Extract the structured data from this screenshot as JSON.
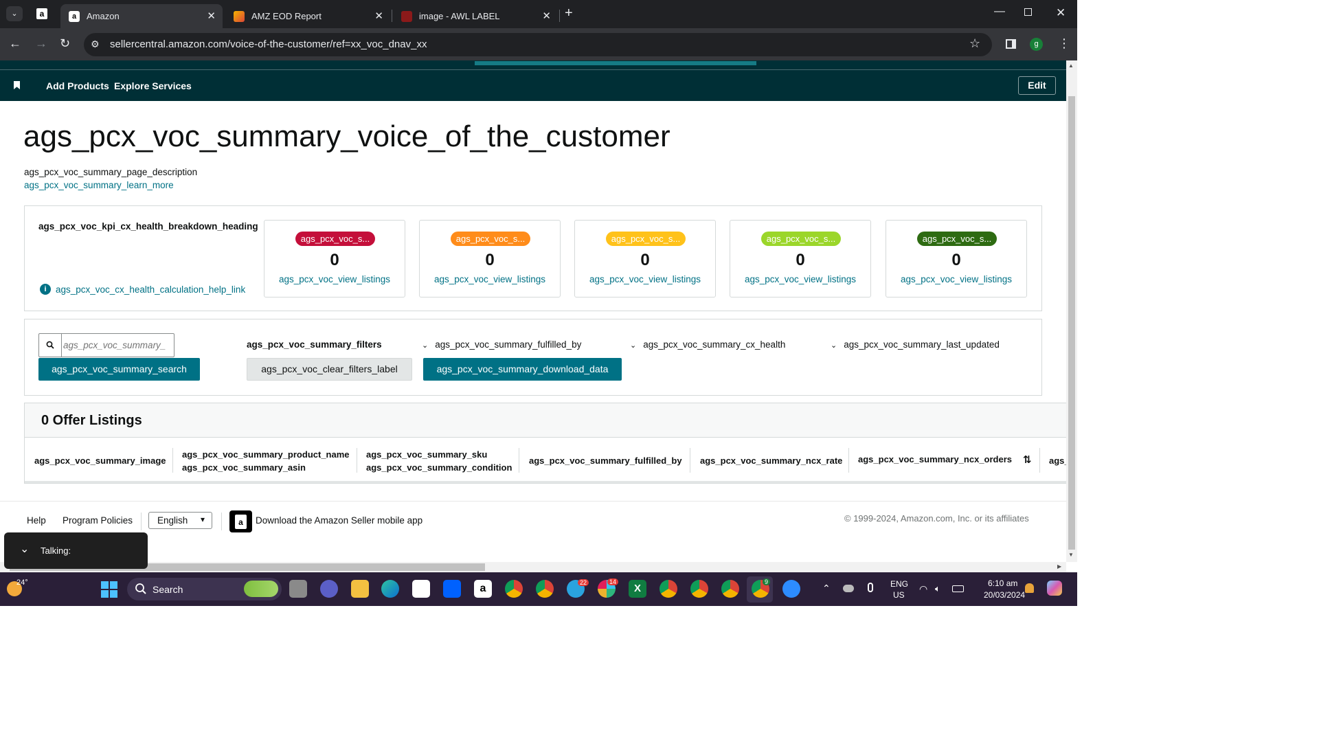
{
  "browser": {
    "tabs": [
      {
        "label": "Amazon",
        "active": true
      },
      {
        "label": "AMZ EOD Report",
        "active": false
      },
      {
        "label": "image - AWL LABEL",
        "active": false
      }
    ],
    "url": "sellercentral.amazon.com/voice-of-the-customer/ref=xx_voc_dnav_xx",
    "profile_letter": "g"
  },
  "nav": {
    "add_products": "Add Products",
    "explore_services": "Explore Services",
    "edit": "Edit"
  },
  "page": {
    "title": "ags_pcx_voc_summary_voice_of_the_customer",
    "description": "ags_pcx_voc_summary_page_description",
    "learn_more": "ags_pcx_voc_summary_learn_more"
  },
  "kpi": {
    "heading": "ags_pcx_voc_kpi_cx_health_breakdown_heading",
    "help_link": "ags_pcx_voc_cx_health_calculation_help_link",
    "cards": [
      {
        "pill": "ags_pcx_voc_s...",
        "color": "#c40f3a",
        "value": "0",
        "link": "ags_pcx_voc_view_listings"
      },
      {
        "pill": "ags_pcx_voc_s...",
        "color": "#ff8c1a",
        "value": "0",
        "link": "ags_pcx_voc_view_listings"
      },
      {
        "pill": "ags_pcx_voc_s...",
        "color": "#ffc21a",
        "value": "0",
        "link": "ags_pcx_voc_view_listings"
      },
      {
        "pill": "ags_pcx_voc_s...",
        "color": "#9bd62a",
        "value": "0",
        "link": "ags_pcx_voc_view_listings"
      },
      {
        "pill": "ags_pcx_voc_s...",
        "color": "#2e6b12",
        "value": "0",
        "link": "ags_pcx_voc_view_listings"
      }
    ]
  },
  "filters": {
    "search_placeholder": "ags_pcx_voc_summary_",
    "search_button": "ags_pcx_voc_summary_search",
    "filters_label": "ags_pcx_voc_summary_filters",
    "clear_filters": "ags_pcx_voc_clear_filters_label",
    "download": "ags_pcx_voc_summary_download_data",
    "dropdowns": [
      "ags_pcx_voc_summary_fulfilled_by",
      "ags_pcx_voc_summary_cx_health",
      "ags_pcx_voc_summary_last_updated"
    ]
  },
  "listings": {
    "heading": "0 Offer Listings",
    "columns": {
      "image": "ags_pcx_voc_summary_image",
      "product_name": "ags_pcx_voc_summary_product_name",
      "asin": "ags_pcx_voc_summary_asin",
      "sku": "ags_pcx_voc_summary_sku",
      "condition": "ags_pcx_voc_summary_condition",
      "fulfilled_by": "ags_pcx_voc_summary_fulfilled_by",
      "ncx_rate": "ags_pcx_voc_summary_ncx_rate",
      "ncx_orders": "ags_pcx_voc_summary_ncx_orders",
      "next": "ags_"
    }
  },
  "footer": {
    "help": "Help",
    "program_policies": "Program Policies",
    "language": "English",
    "mobile_app": "Download the Amazon Seller mobile app",
    "copyright": "© 1999-2024, Amazon.com, Inc. or its affiliates"
  },
  "overlay": {
    "talking": "Talking:"
  },
  "taskbar": {
    "weather": "24°",
    "search": "Search",
    "lang1": "ENG",
    "lang2": "US",
    "time": "6:10 am",
    "date": "20/03/2024",
    "badges": {
      "telegram": "22",
      "slack": "14",
      "chrome_active": "9"
    }
  }
}
